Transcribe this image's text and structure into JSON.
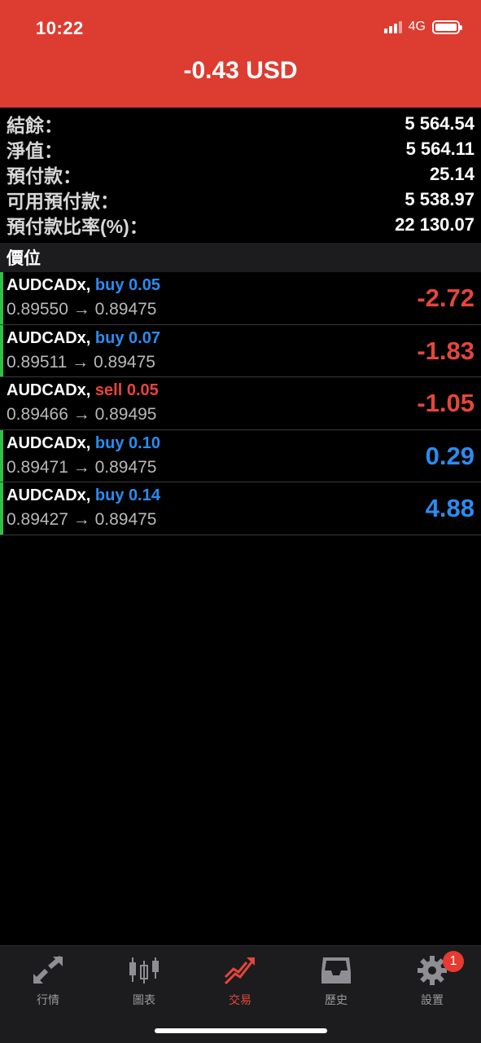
{
  "status": {
    "time": "10:22",
    "network": "4G"
  },
  "header": {
    "title": "-0.43 USD"
  },
  "summary": [
    {
      "label": "結餘：",
      "value": "5 564.54"
    },
    {
      "label": "淨值：",
      "value": "5 564.11"
    },
    {
      "label": "預付款：",
      "value": "25.14"
    },
    {
      "label": "可用預付款：",
      "value": "5 538.97"
    },
    {
      "label": "預付款比率(%)：",
      "value": "22 130.07"
    }
  ],
  "section": {
    "title": "價位"
  },
  "positions": [
    {
      "symbol": "AUDCADx,",
      "side": "buy 0.05",
      "prices": "0.89550 → 0.89475",
      "pl": "-2.72"
    },
    {
      "symbol": "AUDCADx,",
      "side": "buy 0.07",
      "prices": "0.89511 → 0.89475",
      "pl": "-1.83"
    },
    {
      "symbol": "AUDCADx,",
      "side": "sell 0.05",
      "prices": "0.89466 → 0.89495",
      "pl": "-1.05"
    },
    {
      "symbol": "AUDCADx,",
      "side": "buy 0.10",
      "prices": "0.89471 → 0.89475",
      "pl": "0.29"
    },
    {
      "symbol": "AUDCADx,",
      "side": "buy 0.14",
      "prices": "0.89427 → 0.89475",
      "pl": "4.88"
    }
  ],
  "tabs": [
    {
      "label": "行情",
      "icon": "quotes-arrows-icon"
    },
    {
      "label": "圖表",
      "icon": "candlestick-chart-icon"
    },
    {
      "label": "交易",
      "icon": "trade-trend-icon",
      "active": true
    },
    {
      "label": "歷史",
      "icon": "history-inbox-icon"
    },
    {
      "label": "設置",
      "icon": "settings-gear-icon",
      "badge": "1"
    }
  ],
  "colors": {
    "header": "#dd3c30",
    "buy": "#2b8cf0",
    "sell": "#e5463b",
    "indicator": "#30c144"
  }
}
